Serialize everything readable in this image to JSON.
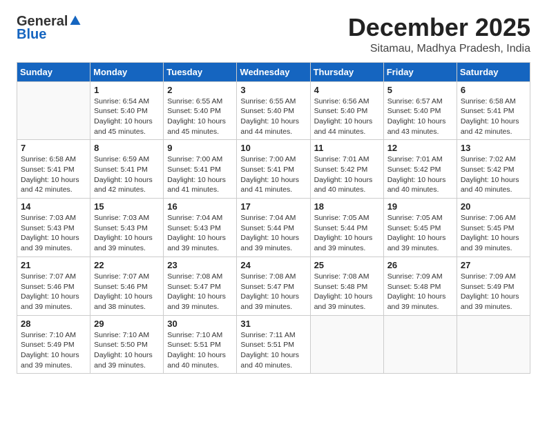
{
  "logo": {
    "general": "General",
    "blue": "Blue"
  },
  "header": {
    "month": "December 2025",
    "location": "Sitamau, Madhya Pradesh, India"
  },
  "weekdays": [
    "Sunday",
    "Monday",
    "Tuesday",
    "Wednesday",
    "Thursday",
    "Friday",
    "Saturday"
  ],
  "weeks": [
    [
      {
        "day": "",
        "info": ""
      },
      {
        "day": "1",
        "info": "Sunrise: 6:54 AM\nSunset: 5:40 PM\nDaylight: 10 hours\nand 45 minutes."
      },
      {
        "day": "2",
        "info": "Sunrise: 6:55 AM\nSunset: 5:40 PM\nDaylight: 10 hours\nand 45 minutes."
      },
      {
        "day": "3",
        "info": "Sunrise: 6:55 AM\nSunset: 5:40 PM\nDaylight: 10 hours\nand 44 minutes."
      },
      {
        "day": "4",
        "info": "Sunrise: 6:56 AM\nSunset: 5:40 PM\nDaylight: 10 hours\nand 44 minutes."
      },
      {
        "day": "5",
        "info": "Sunrise: 6:57 AM\nSunset: 5:40 PM\nDaylight: 10 hours\nand 43 minutes."
      },
      {
        "day": "6",
        "info": "Sunrise: 6:58 AM\nSunset: 5:41 PM\nDaylight: 10 hours\nand 42 minutes."
      }
    ],
    [
      {
        "day": "7",
        "info": "Sunrise: 6:58 AM\nSunset: 5:41 PM\nDaylight: 10 hours\nand 42 minutes."
      },
      {
        "day": "8",
        "info": "Sunrise: 6:59 AM\nSunset: 5:41 PM\nDaylight: 10 hours\nand 42 minutes."
      },
      {
        "day": "9",
        "info": "Sunrise: 7:00 AM\nSunset: 5:41 PM\nDaylight: 10 hours\nand 41 minutes."
      },
      {
        "day": "10",
        "info": "Sunrise: 7:00 AM\nSunset: 5:41 PM\nDaylight: 10 hours\nand 41 minutes."
      },
      {
        "day": "11",
        "info": "Sunrise: 7:01 AM\nSunset: 5:42 PM\nDaylight: 10 hours\nand 40 minutes."
      },
      {
        "day": "12",
        "info": "Sunrise: 7:01 AM\nSunset: 5:42 PM\nDaylight: 10 hours\nand 40 minutes."
      },
      {
        "day": "13",
        "info": "Sunrise: 7:02 AM\nSunset: 5:42 PM\nDaylight: 10 hours\nand 40 minutes."
      }
    ],
    [
      {
        "day": "14",
        "info": "Sunrise: 7:03 AM\nSunset: 5:43 PM\nDaylight: 10 hours\nand 39 minutes."
      },
      {
        "day": "15",
        "info": "Sunrise: 7:03 AM\nSunset: 5:43 PM\nDaylight: 10 hours\nand 39 minutes."
      },
      {
        "day": "16",
        "info": "Sunrise: 7:04 AM\nSunset: 5:43 PM\nDaylight: 10 hours\nand 39 minutes."
      },
      {
        "day": "17",
        "info": "Sunrise: 7:04 AM\nSunset: 5:44 PM\nDaylight: 10 hours\nand 39 minutes."
      },
      {
        "day": "18",
        "info": "Sunrise: 7:05 AM\nSunset: 5:44 PM\nDaylight: 10 hours\nand 39 minutes."
      },
      {
        "day": "19",
        "info": "Sunrise: 7:05 AM\nSunset: 5:45 PM\nDaylight: 10 hours\nand 39 minutes."
      },
      {
        "day": "20",
        "info": "Sunrise: 7:06 AM\nSunset: 5:45 PM\nDaylight: 10 hours\nand 39 minutes."
      }
    ],
    [
      {
        "day": "21",
        "info": "Sunrise: 7:07 AM\nSunset: 5:46 PM\nDaylight: 10 hours\nand 39 minutes."
      },
      {
        "day": "22",
        "info": "Sunrise: 7:07 AM\nSunset: 5:46 PM\nDaylight: 10 hours\nand 38 minutes."
      },
      {
        "day": "23",
        "info": "Sunrise: 7:08 AM\nSunset: 5:47 PM\nDaylight: 10 hours\nand 39 minutes."
      },
      {
        "day": "24",
        "info": "Sunrise: 7:08 AM\nSunset: 5:47 PM\nDaylight: 10 hours\nand 39 minutes."
      },
      {
        "day": "25",
        "info": "Sunrise: 7:08 AM\nSunset: 5:48 PM\nDaylight: 10 hours\nand 39 minutes."
      },
      {
        "day": "26",
        "info": "Sunrise: 7:09 AM\nSunset: 5:48 PM\nDaylight: 10 hours\nand 39 minutes."
      },
      {
        "day": "27",
        "info": "Sunrise: 7:09 AM\nSunset: 5:49 PM\nDaylight: 10 hours\nand 39 minutes."
      }
    ],
    [
      {
        "day": "28",
        "info": "Sunrise: 7:10 AM\nSunset: 5:49 PM\nDaylight: 10 hours\nand 39 minutes."
      },
      {
        "day": "29",
        "info": "Sunrise: 7:10 AM\nSunset: 5:50 PM\nDaylight: 10 hours\nand 39 minutes."
      },
      {
        "day": "30",
        "info": "Sunrise: 7:10 AM\nSunset: 5:51 PM\nDaylight: 10 hours\nand 40 minutes."
      },
      {
        "day": "31",
        "info": "Sunrise: 7:11 AM\nSunset: 5:51 PM\nDaylight: 10 hours\nand 40 minutes."
      },
      {
        "day": "",
        "info": ""
      },
      {
        "day": "",
        "info": ""
      },
      {
        "day": "",
        "info": ""
      }
    ]
  ]
}
